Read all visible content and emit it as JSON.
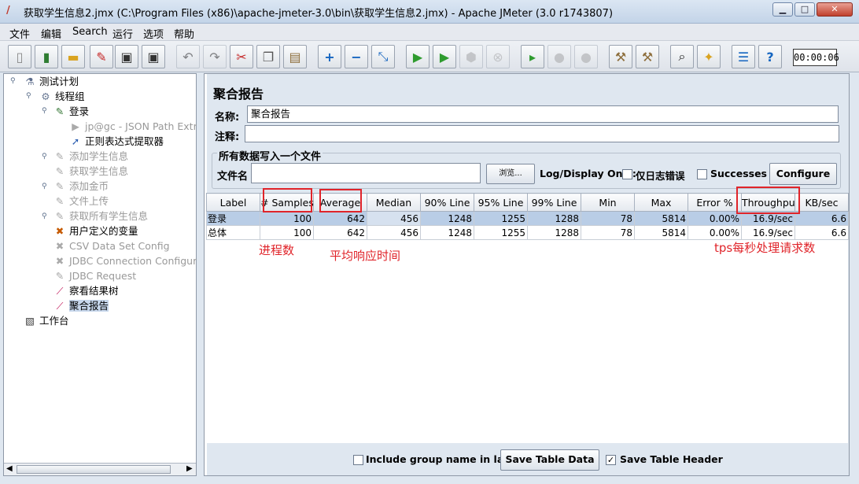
{
  "window": {
    "title": "获取学生信息2.jmx (C:\\Program Files (x86)\\apache-jmeter-3.0\\bin\\获取学生信息2.jmx) - Apache JMeter (3.0 r1743807)",
    "minimize": "▁",
    "maximize": "□",
    "close": "✕"
  },
  "menu": [
    "文件",
    "编辑",
    "Search",
    "运行",
    "选项",
    "帮助"
  ],
  "toolbar": {
    "timer": "00:00:06"
  },
  "tree": {
    "items": [
      {
        "label": "测试计划"
      },
      {
        "label": "线程组"
      },
      {
        "label": "登录"
      },
      {
        "label": "jp@gc - JSON Path Extra"
      },
      {
        "label": "正则表达式提取器"
      },
      {
        "label": "添加学生信息"
      },
      {
        "label": "获取学生信息"
      },
      {
        "label": "添加金币"
      },
      {
        "label": "文件上传"
      },
      {
        "label": "获取所有学生信息"
      },
      {
        "label": "用户定义的变量"
      },
      {
        "label": "CSV Data Set Config"
      },
      {
        "label": "JDBC Connection Configura"
      },
      {
        "label": "JDBC Request"
      },
      {
        "label": "察看结果树"
      },
      {
        "label": "聚合报告"
      },
      {
        "label": "工作台"
      }
    ]
  },
  "panel": {
    "title": "聚合报告",
    "name_label": "名称:",
    "name_value": "聚合报告",
    "comment_label": "注释:",
    "comment_value": "",
    "write_section": "所有数据写入一个文件",
    "filename_label": "文件名",
    "filename_value": "",
    "browse_button": "浏览...",
    "log_display_label": "Log/Display Only:",
    "errors_only_label": "仅日志错误",
    "successes_label": "Successes",
    "configure_button": "Configure"
  },
  "table": {
    "headers": [
      "Label",
      "# Samples",
      "Average",
      "Median",
      "90% Line",
      "95% Line",
      "99% Line",
      "Min",
      "Max",
      "Error %",
      "Throughput",
      "KB/sec"
    ],
    "rows": [
      [
        "登录",
        "100",
        "642",
        "456",
        "1248",
        "1255",
        "1288",
        "78",
        "5814",
        "0.00%",
        "16.9/sec",
        "6.6"
      ],
      [
        "总体",
        "100",
        "642",
        "456",
        "1248",
        "1255",
        "1288",
        "78",
        "5814",
        "0.00%",
        "16.9/sec",
        "6.6"
      ]
    ]
  },
  "annotations": {
    "samples_note": "进程数",
    "average_note": "平均响应时间",
    "throughput_note": "tps每秒处理请求数",
    "color": "#e0242a"
  },
  "footer": {
    "include_group_label": "Include group name in label?",
    "include_group_checked": false,
    "save_data_button": "Save Table Data",
    "save_header_label": "Save Table Header",
    "save_header_checked": true
  }
}
